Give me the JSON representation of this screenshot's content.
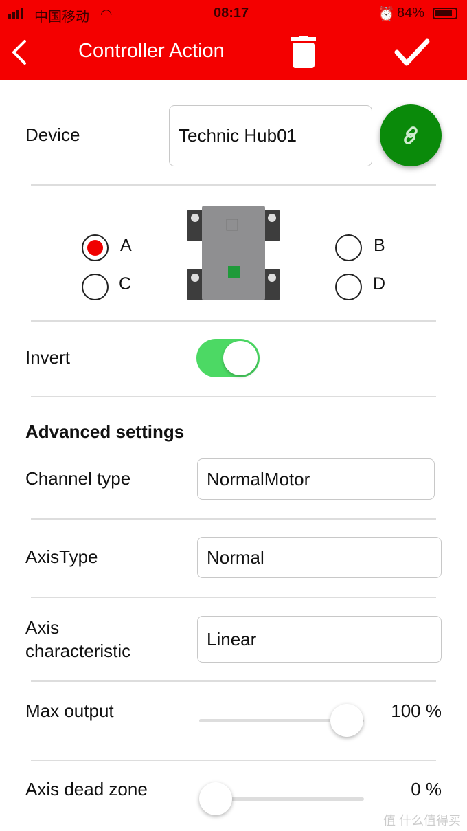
{
  "status_bar": {
    "carrier": "中国移动",
    "time": "08:17",
    "battery": "84%"
  },
  "header": {
    "title": "Controller Action"
  },
  "device": {
    "label": "Device",
    "value": "Technic Hub01"
  },
  "ports": {
    "options": [
      "A",
      "B",
      "C",
      "D"
    ],
    "selected": "A"
  },
  "invert": {
    "label": "Invert",
    "on": true
  },
  "advanced": {
    "heading": "Advanced settings",
    "channel_type": {
      "label": "Channel type",
      "value": "NormalMotor"
    },
    "axis_type": {
      "label": "AxisType",
      "value": "Normal"
    },
    "axis_char": {
      "label1": "Axis",
      "label2": "characteristic",
      "value": "Linear"
    },
    "max_output": {
      "label": "Max output",
      "value_text": "100 %",
      "value": 100
    },
    "dead_zone": {
      "label": "Axis dead zone",
      "value_text": "0 %",
      "value": 0
    }
  },
  "colors": {
    "header": "#f40000",
    "link_button": "#0a8a0a",
    "toggle_on": "#4cd964"
  },
  "watermark": "值 什么值得买"
}
